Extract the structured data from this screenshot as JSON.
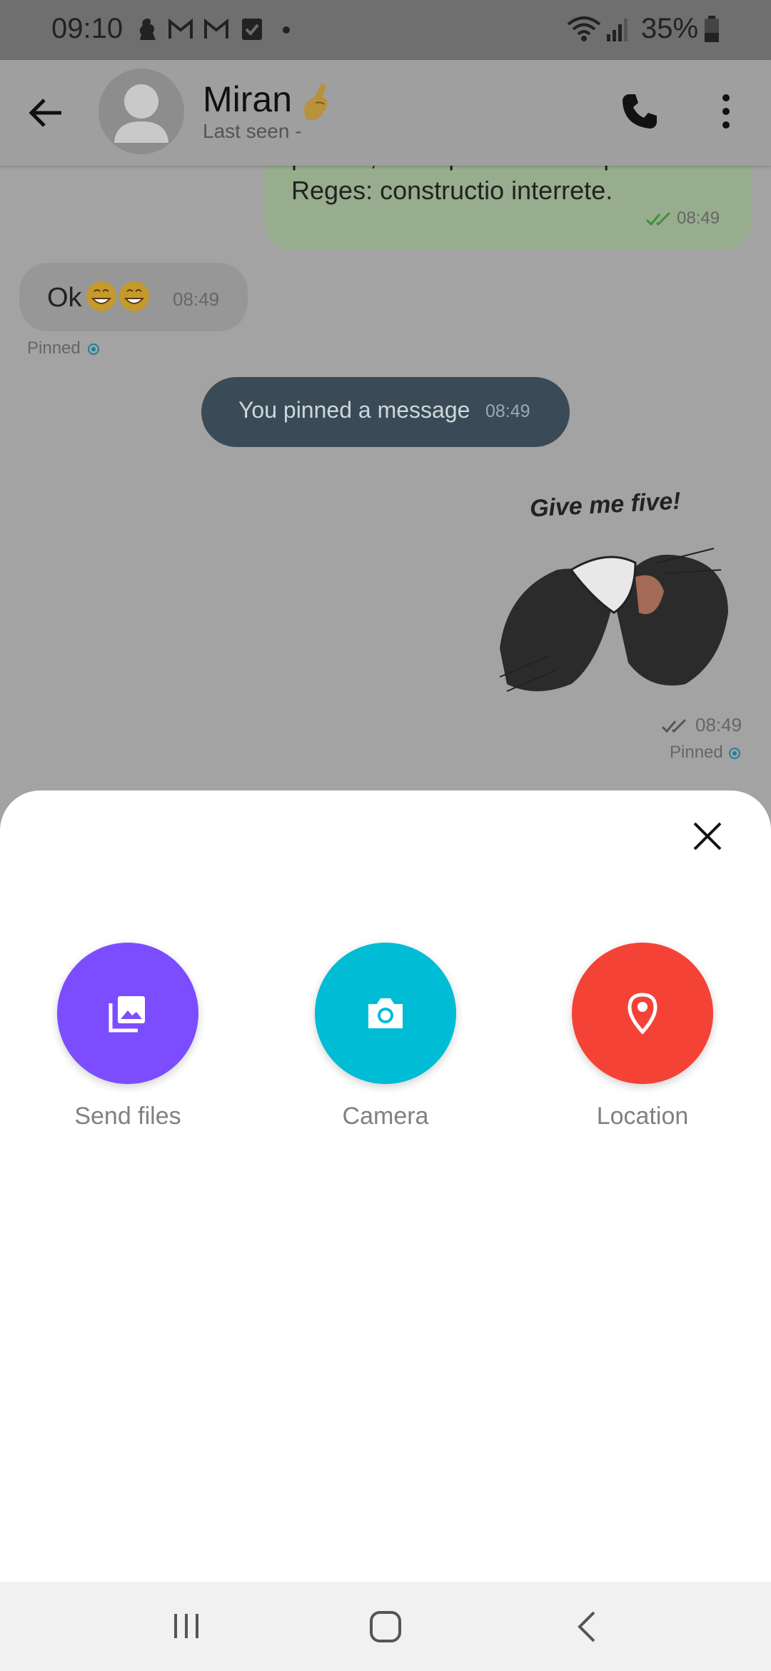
{
  "status_bar": {
    "time": "09:10",
    "battery": "35%"
  },
  "header": {
    "contact_name": "Miran",
    "contact_status": "Last seen -"
  },
  "messages": {
    "outgoing_text_partial": "perfect, at corpus. What's up? Duo",
    "outgoing_text": "Reges: constructio interrete.",
    "outgoing_time": "08:49",
    "incoming_text": "Ok",
    "incoming_time": "08:49",
    "pinned_label": "Pinned",
    "system_text": "You pinned a message",
    "system_time": "08:49",
    "sticker_caption": "Give me five!",
    "sticker_time": "08:49",
    "sticker_pinned_label": "Pinned"
  },
  "sheet": {
    "actions": [
      {
        "label": "Send files",
        "color": "#7c4dff",
        "icon": "image-gallery-icon"
      },
      {
        "label": "Camera",
        "color": "#00bcd4",
        "icon": "camera-icon"
      },
      {
        "label": "Location",
        "color": "#f44336",
        "icon": "location-pin-icon"
      }
    ]
  }
}
